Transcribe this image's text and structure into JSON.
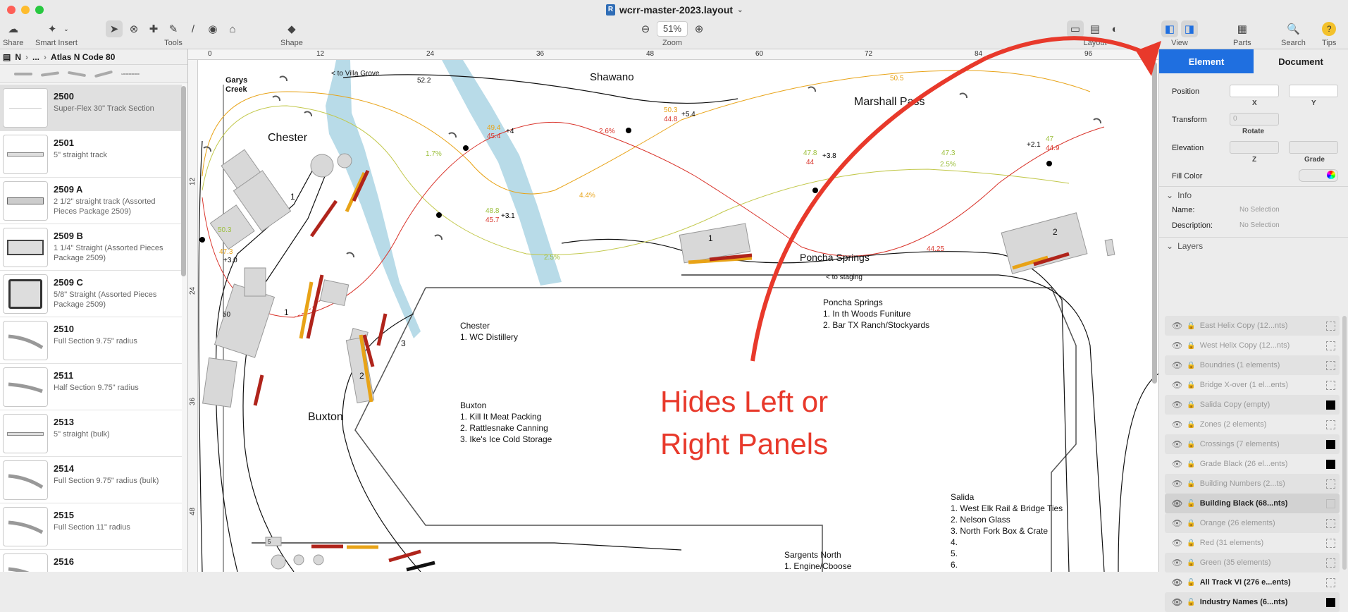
{
  "window": {
    "title": "wcrr-master-2023.layout"
  },
  "toolbar": {
    "share": "Share",
    "smart_insert": "Smart Insert",
    "tools": "Tools",
    "shape": "Shape",
    "zoom_label": "Zoom",
    "zoom_value": "51%",
    "layout": "Layout",
    "view": "View",
    "parts": "Parts",
    "search": "Search",
    "tips": "Tips"
  },
  "left_panel": {
    "breadcrumb": [
      "N",
      "...",
      "Atlas N Code 80"
    ],
    "parts": [
      {
        "number": "2500",
        "desc": "Super-Flex 30\" Track Section"
      },
      {
        "number": "2501",
        "desc": "5\" straight track"
      },
      {
        "number": "2509 A",
        "desc": "2 1/2\" straight track (Assorted Pieces Package 2509)"
      },
      {
        "number": "2509 B",
        "desc": "1 1/4\" Straight  (Assorted Pieces Package 2509)"
      },
      {
        "number": "2509 C",
        "desc": "5/8\" Straight (Assorted Pieces Package 2509)"
      },
      {
        "number": "2510",
        "desc": "Full Section 9.75\" radius"
      },
      {
        "number": "2511",
        "desc": "Half Section 9.75\" radius"
      },
      {
        "number": "2513",
        "desc": "5\" straight (bulk)"
      },
      {
        "number": "2514",
        "desc": "Full Section 9.75\" radius (bulk)"
      },
      {
        "number": "2515",
        "desc": "Full Section 11\" radius"
      },
      {
        "number": "2516",
        "desc": ""
      }
    ]
  },
  "canvas": {
    "ruler_top": [
      "0",
      "12",
      "24",
      "36",
      "48",
      "60",
      "72",
      "84",
      "96"
    ],
    "ruler_left": [
      "12",
      "24",
      "36",
      "48"
    ],
    "labels": {
      "garys": "Garys",
      "creek": "Creek",
      "villa_grove": "< to Villa Grove",
      "shawano": "Shawano",
      "marshall_pass": "Marshall Pass",
      "chester": "Chester",
      "poncha_springs": "Poncha Springs",
      "to_staging": "< to staging",
      "buxton": "Buxton",
      "b1": "1",
      "b2": "2",
      "b3": "3",
      "b4": "1",
      "b5": "1",
      "b6": "2",
      "b7": "5",
      "fifty": "50",
      "g_52_2": "52.2",
      "g_50_5": "50.5"
    },
    "grades": [
      {
        "t": "49.4",
        "c": "orange"
      },
      {
        "t": "45.4",
        "c": "red"
      },
      {
        "t": "+4",
        "c": "black"
      },
      {
        "t": "2.6%",
        "c": "red"
      },
      {
        "t": "50.3",
        "c": "orange"
      },
      {
        "t": "44.8",
        "c": "red"
      },
      {
        "t": "+5.4",
        "c": "black"
      },
      {
        "t": "1.7%",
        "c": "green"
      },
      {
        "t": "47.8",
        "c": "green"
      },
      {
        "t": "44",
        "c": "red"
      },
      {
        "t": "+3.8",
        "c": "black"
      },
      {
        "t": "47.3",
        "c": "green"
      },
      {
        "t": "2.5%",
        "c": "green"
      },
      {
        "t": "+2.1",
        "c": "black"
      },
      {
        "t": "47",
        "c": "green"
      },
      {
        "t": "44.9",
        "c": "red"
      },
      {
        "t": "4.4%",
        "c": "orange"
      },
      {
        "t": "48.8",
        "c": "green"
      },
      {
        "t": "45.7",
        "c": "red"
      },
      {
        "t": "+3.1",
        "c": "black"
      },
      {
        "t": "50.3",
        "c": "green"
      },
      {
        "t": "47.3",
        "c": "orange"
      },
      {
        "t": "+3.0",
        "c": "black"
      },
      {
        "t": "2.5%",
        "c": "green"
      },
      {
        "t": "44.25",
        "c": "red"
      }
    ],
    "industries": {
      "chester": [
        "Chester",
        "1. WC Distillery"
      ],
      "buxton": [
        "Buxton",
        "1. Kill It Meat Packing",
        "2. Rattlesnake Canning",
        "3. Ike's Ice Cold Storage"
      ],
      "poncha": [
        "Poncha Springs",
        "1. In th Woods Funiture",
        "2. Bar TX Ranch/Stockyards"
      ],
      "salida": [
        "Salida",
        "1. West Elk Rail & Bridge Ties",
        "2. Nelson Glass",
        "3. North Fork Box & Crate",
        "4.",
        "5.",
        "6."
      ],
      "sargents": [
        "Sargents North",
        "1. Engine/Cboose"
      ]
    },
    "callout": {
      "line1": "Hides Left or",
      "line2": "Right Panels"
    }
  },
  "right_panel": {
    "tabs": [
      "Element",
      "Document"
    ],
    "position": "Position",
    "x": "X",
    "y": "Y",
    "transform": "Transform",
    "rotate_placeholder": "0",
    "rotate": "Rotate",
    "elevation": "Elevation",
    "z": "Z",
    "grade": "Grade",
    "fill_color": "Fill Color",
    "info": "Info",
    "name": "Name:",
    "description": "Description:",
    "no_selection": "No Selection",
    "layers_title": "Layers",
    "layers": [
      {
        "name": "East Helix Copy  (12...nts)",
        "swatch": "none"
      },
      {
        "name": "West Helix Copy  (12...nts)",
        "swatch": "none"
      },
      {
        "name": "Boundries  (1 elements)",
        "swatch": "none"
      },
      {
        "name": "Bridge X-over  (1 el...ents)",
        "swatch": "none"
      },
      {
        "name": "Salida Copy  (empty)",
        "swatch": "black"
      },
      {
        "name": "Zones  (2 elements)",
        "swatch": "none"
      },
      {
        "name": "Crossings  (7 elements)",
        "swatch": "black"
      },
      {
        "name": "Grade Black  (26 el...ents)",
        "swatch": "black"
      },
      {
        "name": "Building Numbers  (2...ts)",
        "swatch": "none"
      },
      {
        "name": "Building Black  (68...nts)",
        "swatch": "none"
      },
      {
        "name": "Orange  (26 elements)",
        "swatch": "none"
      },
      {
        "name": "Red  (31 elements)",
        "swatch": "none"
      },
      {
        "name": "Green  (35 elements)",
        "swatch": "none"
      },
      {
        "name": "All Track VI  (276 e...ents)",
        "swatch": "none"
      },
      {
        "name": "Industry Names  (6...nts)",
        "swatch": "black"
      }
    ]
  },
  "colors": {
    "accent": "#1f6fe0",
    "callout": "#e8392b",
    "river": "#add8e6",
    "orange": "#e8a317",
    "red": "#d9342b",
    "green": "#9bbf3b"
  }
}
